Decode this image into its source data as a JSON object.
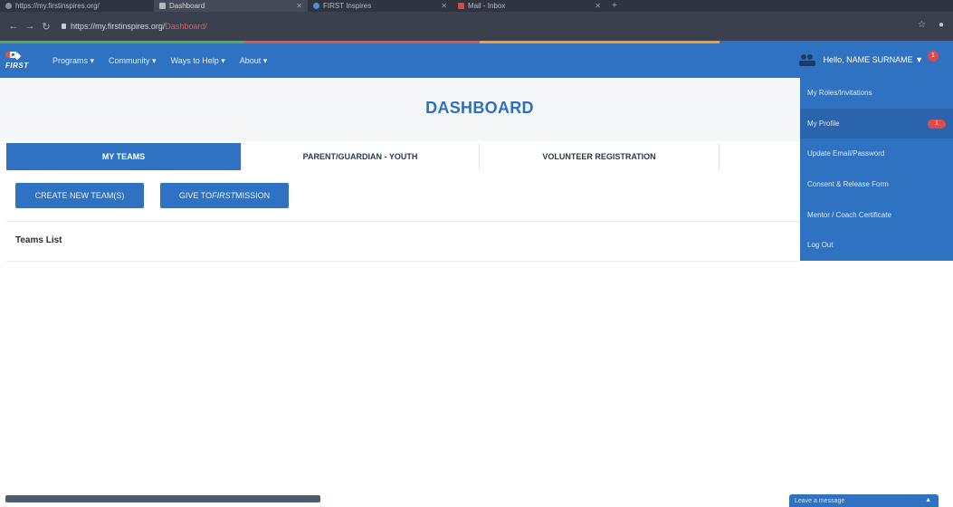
{
  "browser": {
    "tabs": [
      {
        "label": "https://my.firstinspires.org/",
        "active": false
      },
      {
        "label": "Dashboard",
        "active": true
      },
      {
        "label": "FIRST Inspires",
        "active": false
      },
      {
        "label": "Mail - Inbox",
        "active": false
      }
    ],
    "url_host": "https://my.firstinspires.org/",
    "url_path": "Dashboard/"
  },
  "nav": {
    "logo_text": "FIRST",
    "links": [
      "Programs ▾",
      "Community ▾",
      "Ways to Help ▾",
      "About ▾"
    ],
    "user_greeting": "Hello, NAME SURNAME ▼",
    "notification_count": "1"
  },
  "page": {
    "title": "DASHBOARD",
    "tabs": [
      "MY TEAMS",
      "PARENT/GUARDIAN - YOUTH",
      "VOLUNTEER REGISTRATION",
      ""
    ],
    "create_button": "CREATE NEW TEAM(S)",
    "give_prefix": "GIVE TO ",
    "give_emphasis": "FIRST",
    "give_suffix": " MISSION",
    "teams_list_label": "Teams List"
  },
  "menu": {
    "items": [
      {
        "label": "My Roles/Invitations"
      },
      {
        "label": "My Profile",
        "badge": "1"
      },
      {
        "label": "Update Email/Password"
      },
      {
        "label": "Consent & Release Form"
      },
      {
        "label": "Mentor / Coach Certificate"
      },
      {
        "label": "Log Out"
      }
    ]
  },
  "footer": {
    "widget_label": "Leave a message"
  },
  "colors": {
    "brand_blue": "#2f72c2",
    "title_blue": "#2f6fbe",
    "alert_red": "#e04747"
  }
}
